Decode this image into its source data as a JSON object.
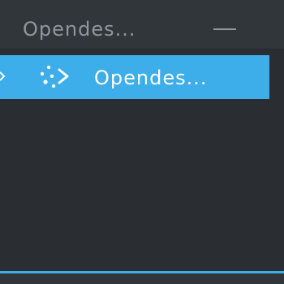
{
  "window": {
    "title": "Opendes...",
    "minimize_icon": "minimize-icon"
  },
  "list": {
    "items": [
      {
        "label": "Opendes...",
        "icon": "dotted-arrow-icon",
        "expander_icon": "chevron-right-icon",
        "selected": true
      }
    ]
  },
  "colors": {
    "background": "#2a2e32",
    "titlebar": "#31363b",
    "selection": "#3daee9",
    "muted_text": "#8f969c",
    "selected_text": "#ffffff"
  }
}
